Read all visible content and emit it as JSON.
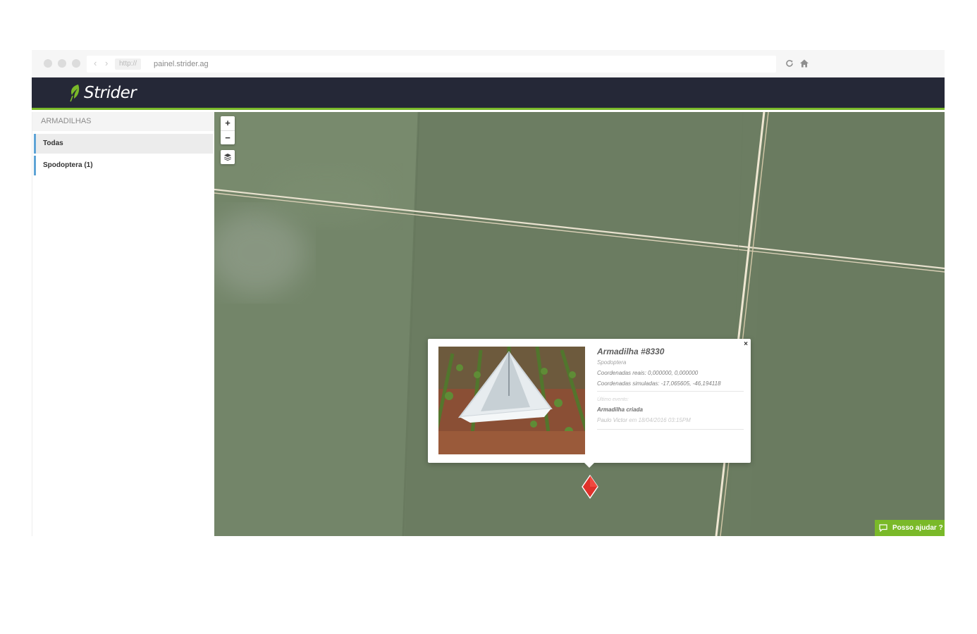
{
  "browser": {
    "url_scheme": "http://",
    "url": "painel.strider.ag",
    "nav_arrows": "‹ ›"
  },
  "app": {
    "brand": "Strider",
    "accent_color": "#7ab929",
    "header_color": "#252837"
  },
  "sidebar": {
    "title": "ARMADILHAS",
    "items": [
      {
        "label": "Todas",
        "active": true
      },
      {
        "label": "Spodoptera (1)",
        "active": false
      }
    ]
  },
  "map": {
    "zoom_in": "+",
    "zoom_out": "−",
    "icons": [
      "layers-icon",
      "trap-marker-icon"
    ]
  },
  "popup": {
    "close": "×",
    "title": "Armadilha #8330",
    "species": "Spodoptera",
    "coords_real": "Coordenadas reais: 0,000000, 0,000000",
    "coords_sim": "Coordenadas simuladas: -17,065605, -46,194118",
    "last_event_label": "Último evento:",
    "event": "Armadilha criada",
    "author": "Paulo Victor",
    "author_suffix": " em 18/04/2016 03:15PM"
  },
  "help": {
    "label": "Posso ajudar ?"
  }
}
